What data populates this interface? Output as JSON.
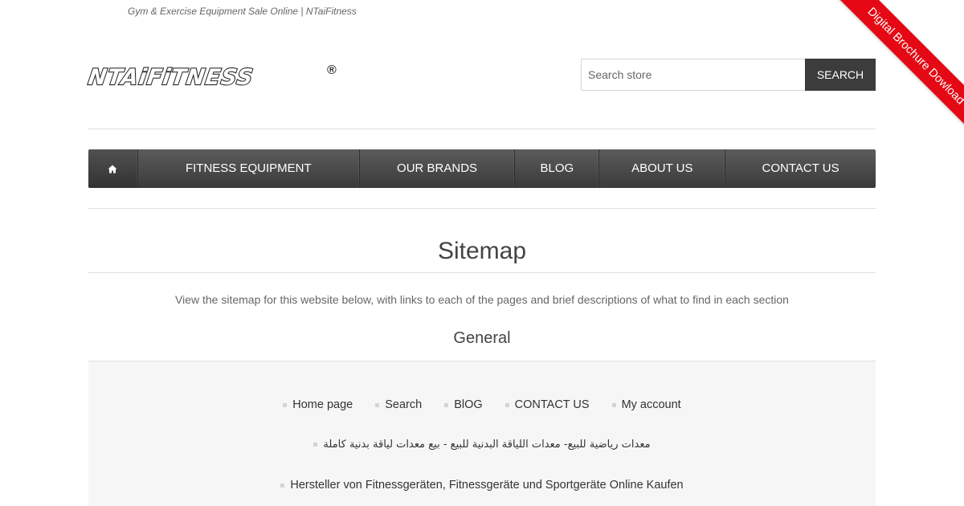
{
  "header": {
    "tagline": "Gym & Exercise Equipment Sale Online | NTaiFitness",
    "logo_text": "NTAiFiTNESS",
    "logo_mark": "®"
  },
  "search": {
    "placeholder": "Search store",
    "button_label": "SEARCH"
  },
  "ribbon": {
    "label": "Digital Brochure Dowload",
    "color": "#e40914"
  },
  "nav": {
    "home_icon": "home-icon",
    "items": [
      {
        "label": "FITNESS EQUIPMENT"
      },
      {
        "label": "OUR BRANDS"
      },
      {
        "label": "BLOG"
      },
      {
        "label": "ABOUT US"
      },
      {
        "label": "CONTACT US"
      }
    ]
  },
  "main": {
    "title": "Sitemap",
    "description": "View the sitemap for this website below, with links to each of the pages and brief descriptions of what to find in each section",
    "section_title": "General",
    "links_row1": [
      {
        "label": "Home page"
      },
      {
        "label": "Search"
      },
      {
        "label": "BlOG"
      },
      {
        "label": "CONTACT US"
      },
      {
        "label": "My account"
      }
    ],
    "link_arabic": "معدات رياضية للبيع- معدات اللياقة البدنية للبيع - بيع معدات لياقة بدنية كاملة",
    "link_german": "Hersteller von Fitnessgeräten, Fitnessgeräte und Sportgeräte Online Kaufen"
  }
}
